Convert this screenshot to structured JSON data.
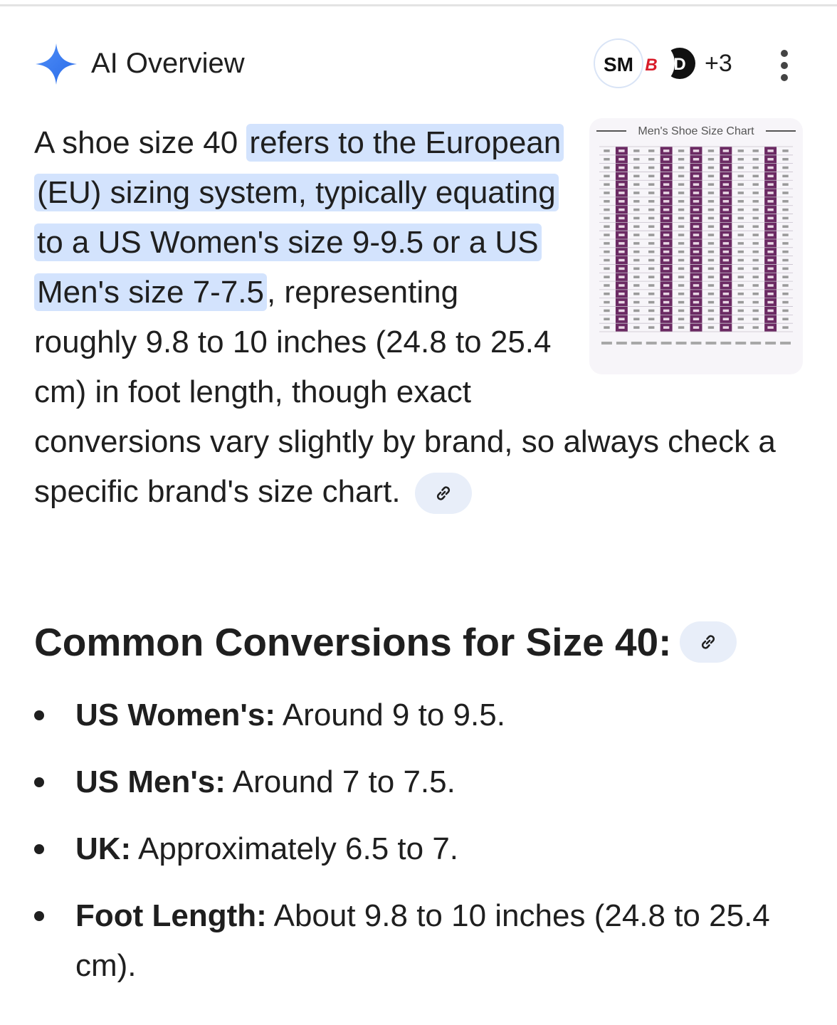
{
  "header": {
    "title": "AI Overview",
    "sources_more": "+3",
    "source_logos": [
      {
        "text": "SM",
        "color": "#111111"
      },
      {
        "text": "B",
        "color": "#d81c2a"
      },
      {
        "text": "D",
        "color": "#111111"
      }
    ]
  },
  "thumbnail": {
    "title": "Men's Shoe Size Chart",
    "accent_color": "#6b2a63"
  },
  "paragraph": {
    "intro": "A shoe size 40 ",
    "highlight_1": "refers to the European (EU) sizing system, typically equating to a US Women's size 9-9.5 or a US Men's size 7-7.5",
    "rest": ", representing roughly 9.8 to 10 inches (24.8 to 25.4 cm) in foot length, though exact conversions vary slightly by brand, so always check a specific brand's size chart."
  },
  "section": {
    "heading": "Common Conversions for Size 40:"
  },
  "bullets": [
    {
      "label": "US Women's:",
      "text": " Around 9 to 9.5."
    },
    {
      "label": "US Men's:",
      "text": " Around 7 to 7.5."
    },
    {
      "label": "UK:",
      "text": " Approximately 6.5 to 7."
    },
    {
      "label": "Foot Length:",
      "text": " About 9.8 to 10 inches (24.8 to 25.4 cm)."
    }
  ],
  "colors": {
    "highlight": "#d3e3fd",
    "spark": "#4285f4",
    "chip": "#e8eef9"
  }
}
